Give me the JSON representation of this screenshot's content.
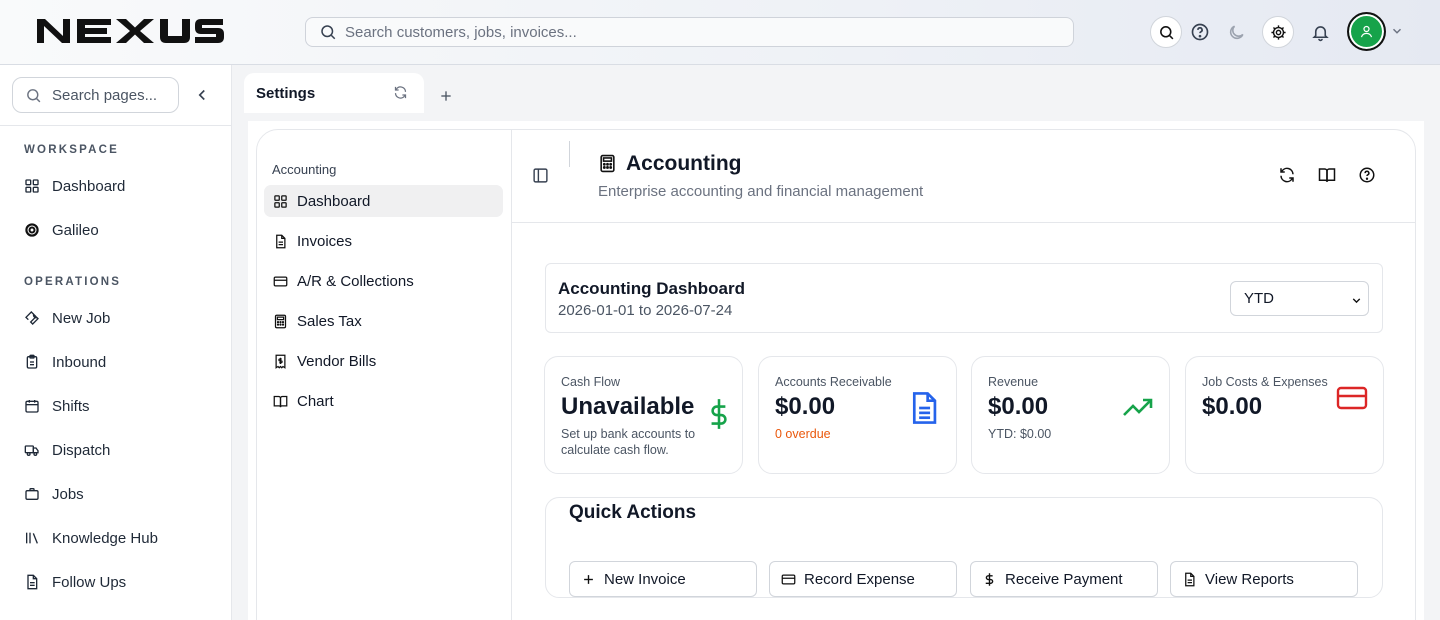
{
  "header": {
    "logo_text": "NEXUS",
    "search": {
      "placeholder": "Search customers, jobs, invoices..."
    },
    "icons": [
      "search-icon",
      "help-icon",
      "moon-icon",
      "settings-icon",
      "bell-icon",
      "user-icon"
    ],
    "avatar_color": "#16a34a"
  },
  "sidebar": {
    "search_placeholder": "Search pages...",
    "sections": [
      {
        "title": "WORKSPACE",
        "items": [
          {
            "label": "Dashboard",
            "icon": "grid-icon"
          },
          {
            "label": "Galileo",
            "icon": "galileo-icon"
          }
        ]
      },
      {
        "title": "OPERATIONS",
        "items": [
          {
            "label": "New Job",
            "icon": "wrench-icon"
          },
          {
            "label": "Inbound",
            "icon": "clipboard-icon"
          },
          {
            "label": "Shifts",
            "icon": "calendar-icon"
          },
          {
            "label": "Dispatch",
            "icon": "truck-icon"
          },
          {
            "label": "Jobs",
            "icon": "briefcase-icon"
          },
          {
            "label": "Knowledge Hub",
            "icon": "library-icon"
          },
          {
            "label": "Follow Ups",
            "icon": "document-icon"
          }
        ]
      }
    ]
  },
  "tabs": [
    {
      "label": "Settings"
    }
  ],
  "subnav": {
    "title": "Accounting",
    "items": [
      {
        "label": "Dashboard",
        "icon": "grid-icon",
        "active": true
      },
      {
        "label": "Invoices",
        "icon": "document-icon"
      },
      {
        "label": "A/R & Collections",
        "icon": "credit-card-icon"
      },
      {
        "label": "Sales Tax",
        "icon": "calculator-icon"
      },
      {
        "label": "Vendor Bills",
        "icon": "receipt-icon"
      },
      {
        "label": "Chart",
        "icon": "book-icon"
      }
    ]
  },
  "page": {
    "title": "Accounting",
    "subtitle": "Enterprise accounting and financial management"
  },
  "dashboard": {
    "title": "Accounting Dashboard",
    "date_range": "2026-01-01 to 2026-07-24",
    "period": "YTD"
  },
  "kpis": [
    {
      "label": "Cash Flow",
      "value": "Unavailable",
      "note": "Set up bank accounts to calculate cash flow.",
      "icon": "dollar-icon",
      "color": "#16a34a"
    },
    {
      "label": "Accounts Receivable",
      "value": "$0.00",
      "note": "0 overdue",
      "icon": "document-icon",
      "color": "#2563eb",
      "note_color": "#ea580c"
    },
    {
      "label": "Revenue",
      "value": "$0.00",
      "note": "YTD: $0.00",
      "icon": "trending-up-icon",
      "color": "#16a34a"
    },
    {
      "label": "Job Costs & Expenses",
      "value": "$0.00",
      "note": "",
      "icon": "credit-card-icon",
      "color": "#dc2626"
    }
  ],
  "quick_actions": {
    "title": "Quick Actions",
    "buttons": [
      {
        "label": "New Invoice",
        "icon": "plus-icon"
      },
      {
        "label": "Record Expense",
        "icon": "credit-card-icon"
      },
      {
        "label": "Receive Payment",
        "icon": "dollar-icon"
      },
      {
        "label": "View Reports",
        "icon": "document-icon"
      }
    ]
  }
}
